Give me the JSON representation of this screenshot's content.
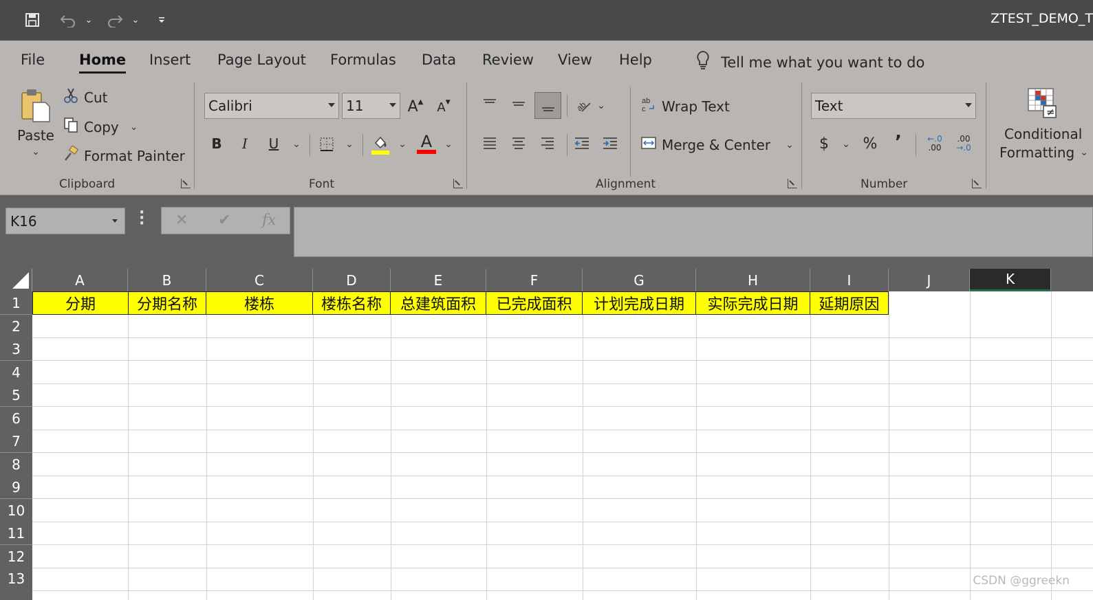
{
  "title": "ZTEST_DEMO_T",
  "qat": {
    "save_icon": "save-icon",
    "undo_icon": "undo-icon",
    "redo_icon": "redo-icon",
    "customize_icon": "customize-qat-icon"
  },
  "tabs": [
    "File",
    "Home",
    "Insert",
    "Page Layout",
    "Formulas",
    "Data",
    "Review",
    "View",
    "Help"
  ],
  "active_tab": "Home",
  "tell_me": "Tell me what you want to do",
  "clipboard": {
    "paste": "Paste",
    "cut": "Cut",
    "copy": "Copy",
    "format_painter": "Format Painter",
    "group": "Clipboard"
  },
  "font": {
    "name": "Calibri",
    "size": "11",
    "bold": "B",
    "italic": "I",
    "underline": "U",
    "grow": "A",
    "shrink": "A",
    "font_color_letter": "A",
    "group": "Font",
    "fill_color": "#ffff00",
    "font_color": "#ff0000"
  },
  "alignment": {
    "wrap_text": "Wrap Text",
    "merge_center": "Merge & Center",
    "group": "Alignment"
  },
  "number": {
    "format": "Text",
    "currency": "$",
    "percent": "%",
    "comma": "’",
    "group": "Number",
    "inc_top": "←.0",
    "inc_bottom": ".00",
    "dec_top": ".00",
    "dec_bottom": "→.0"
  },
  "styles": {
    "conditional_line1": "Conditional",
    "conditional_line2": "Formatting"
  },
  "formula_bar": {
    "name_box": "K16",
    "cancel": "✕",
    "enter": "✔",
    "fx": "fx",
    "formula": ""
  },
  "columns": [
    "A",
    "B",
    "C",
    "D",
    "E",
    "F",
    "G",
    "H",
    "I",
    "J",
    "K"
  ],
  "selected_column": "K",
  "rows": [
    "1",
    "2",
    "3",
    "4",
    "5",
    "6",
    "7",
    "8",
    "9",
    "10",
    "11",
    "12",
    "13"
  ],
  "header_row": [
    "分期",
    "分期名称",
    "楼栋",
    "楼栋名称",
    "总建筑面积",
    "已完成面积",
    "计划完成日期",
    "实际完成日期",
    "延期原因"
  ],
  "header_fill": "#ffff00",
  "watermark": "CSDN @ggreekn"
}
